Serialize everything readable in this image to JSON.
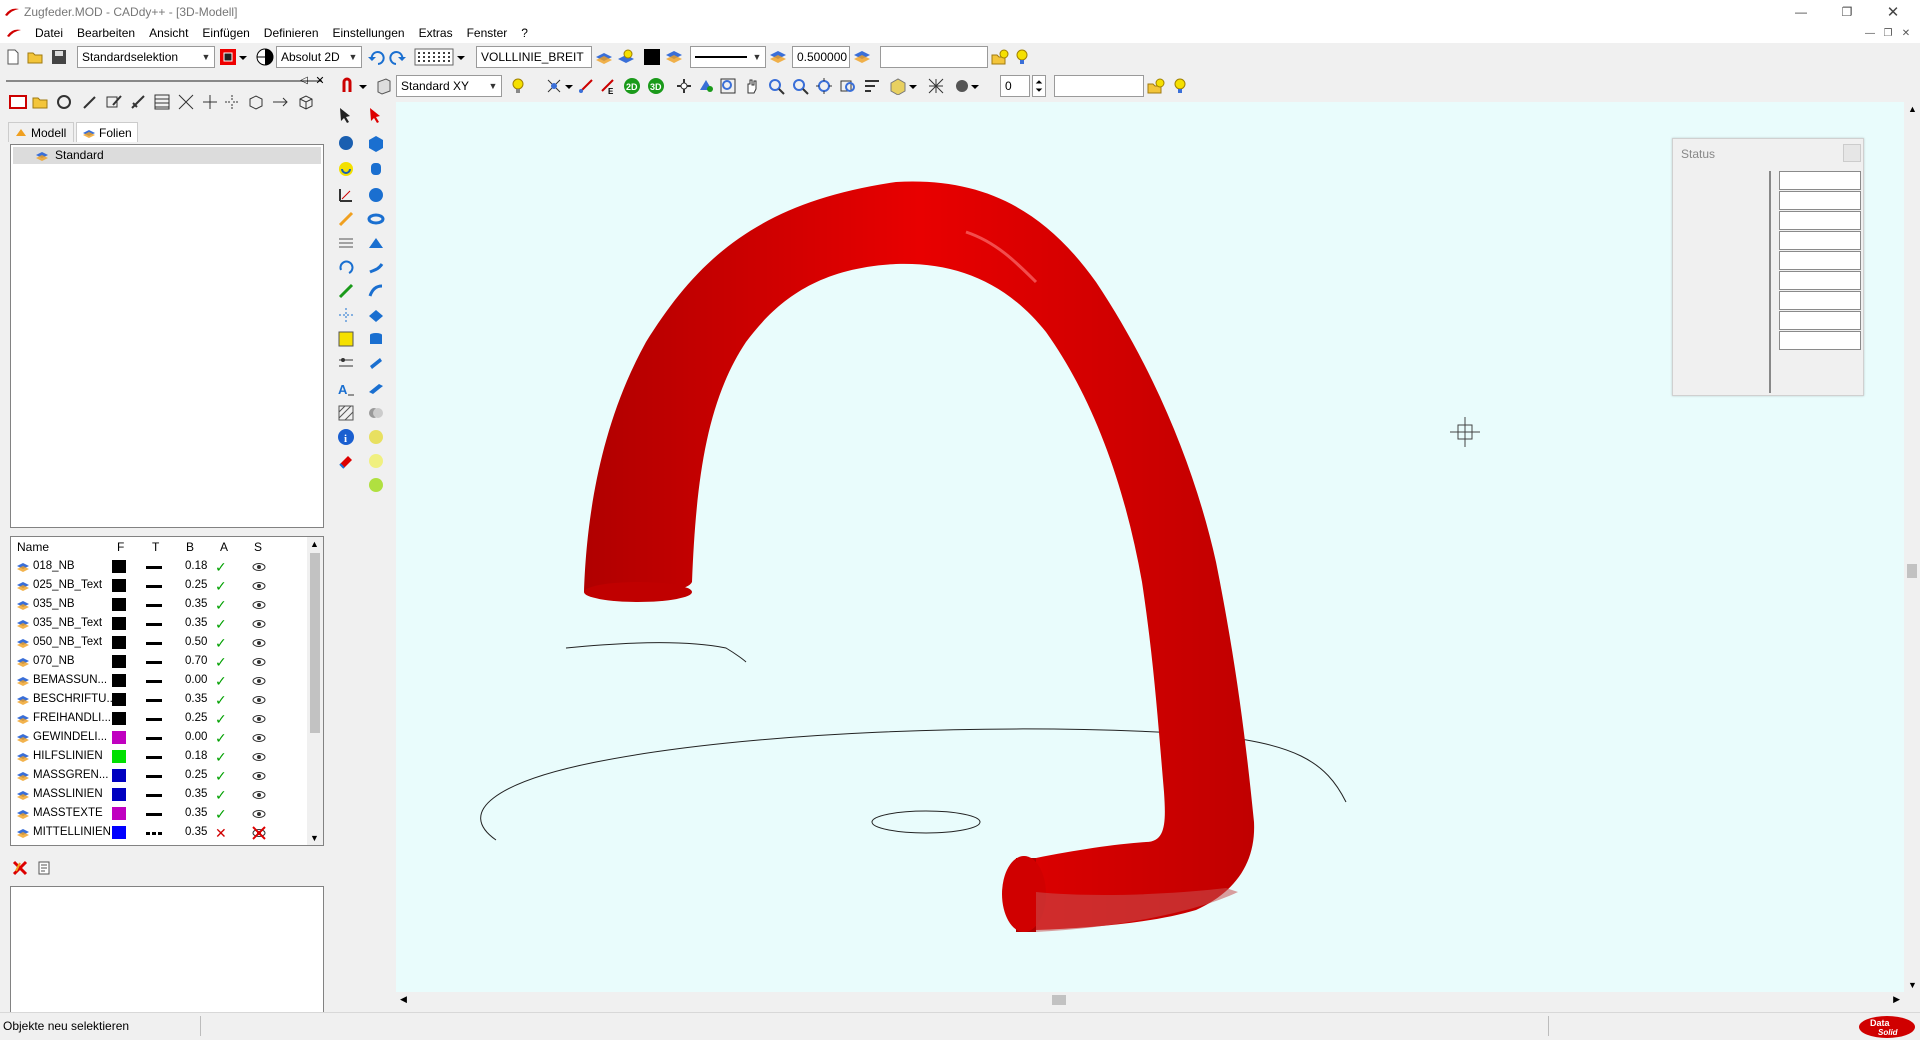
{
  "window": {
    "title": "Zugfeder.MOD - CADdy++ - [3D-Modell]"
  },
  "menu": {
    "items": [
      "Datei",
      "Bearbeiten",
      "Ansicht",
      "Einfügen",
      "Definieren",
      "Einstellungen",
      "Extras",
      "Fenster",
      "?"
    ]
  },
  "toolbar1": {
    "selection_mode": "Standardselektion",
    "coord_mode": "Absolut 2D",
    "line_type_name": "VOLLLINIE_BREIT",
    "line_width": "0.500000",
    "text_field": ""
  },
  "toolbar2": {
    "view_plane": "Standard XY",
    "layer_number": "0",
    "text_field": "",
    "btn_2d": "2D",
    "btn_3d": "3D"
  },
  "left_panel": {
    "tabs": [
      "Modell",
      "Folien"
    ],
    "tree_item": "Standard",
    "table_headers": {
      "name": "Name",
      "f": "F",
      "t": "T",
      "b": "B",
      "a": "A",
      "s": "S"
    },
    "layers": [
      {
        "name": "018_NB",
        "color": "#000000",
        "width": "0.18",
        "active": true,
        "visible": true,
        "line": "solid"
      },
      {
        "name": "025_NB_Text",
        "color": "#000000",
        "width": "0.25",
        "active": true,
        "visible": true,
        "line": "solid"
      },
      {
        "name": "035_NB",
        "color": "#000000",
        "width": "0.35",
        "active": true,
        "visible": true,
        "line": "solid"
      },
      {
        "name": "035_NB_Text",
        "color": "#000000",
        "width": "0.35",
        "active": true,
        "visible": true,
        "line": "solid"
      },
      {
        "name": "050_NB_Text",
        "color": "#000000",
        "width": "0.50",
        "active": true,
        "visible": true,
        "line": "solid"
      },
      {
        "name": "070_NB",
        "color": "#000000",
        "width": "0.70",
        "active": true,
        "visible": true,
        "line": "solid"
      },
      {
        "name": "BEMASSUN...",
        "color": "#000000",
        "width": "0.00",
        "active": true,
        "visible": true,
        "line": "solid"
      },
      {
        "name": "BESCHRIFTU...",
        "color": "#000000",
        "width": "0.35",
        "active": true,
        "visible": true,
        "line": "solid"
      },
      {
        "name": "FREIHANDLI...",
        "color": "#000000",
        "width": "0.25",
        "active": true,
        "visible": true,
        "line": "solid"
      },
      {
        "name": "GEWINDELI...",
        "color": "#c000c0",
        "width": "0.00",
        "active": true,
        "visible": true,
        "line": "solid"
      },
      {
        "name": "HILFSLINIEN",
        "color": "#00e000",
        "width": "0.18",
        "active": true,
        "visible": true,
        "line": "solid"
      },
      {
        "name": "MASSGREN...",
        "color": "#0000c0",
        "width": "0.25",
        "active": true,
        "visible": true,
        "line": "solid"
      },
      {
        "name": "MASSLINIEN",
        "color": "#0000c0",
        "width": "0.35",
        "active": true,
        "visible": true,
        "line": "solid"
      },
      {
        "name": "MASSTEXTE",
        "color": "#c000c0",
        "width": "0.35",
        "active": true,
        "visible": true,
        "line": "solid"
      },
      {
        "name": "MITTELLINIEN",
        "color": "#0000ff",
        "width": "0.35",
        "active": false,
        "visible": false,
        "line": "dash"
      }
    ]
  },
  "status_panel": {
    "title": "Status"
  },
  "statusbar": {
    "message": "Objekte neu selektieren"
  },
  "colors": {
    "viewport_bg": "#e9fcfc",
    "model_red": "#e00000",
    "accent_check": "#00a000"
  }
}
